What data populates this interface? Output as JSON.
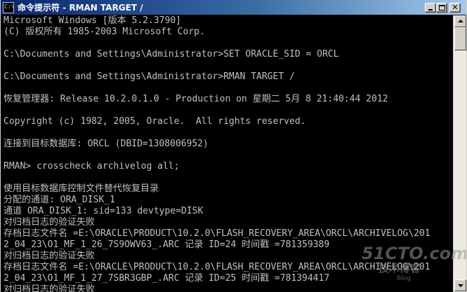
{
  "window": {
    "title": "命令提示符 - RMAN TARGET /",
    "icon": "cmd-icon",
    "icon_text": "C:\\",
    "controls": {
      "minimize": "minimize-icon",
      "maximize": "maximize-icon",
      "close": "close-icon",
      "close_glyph": "✕"
    }
  },
  "console": {
    "lines": [
      "Microsoft Windows [版本 5.2.3790]",
      "(C) 版权所有 1985-2003 Microsoft Corp.",
      "",
      "C:\\Documents and Settings\\Administrator>SET ORACLE_SID = ORCL",
      "",
      "C:\\Documents and Settings\\Administrator>RMAN TARGET /",
      "",
      "恢复管理器: Release 10.2.0.1.0 - Production on 星期二 5月 8 21:40:44 2012",
      "",
      "Copyright (c) 1982, 2005, Oracle.  All rights reserved.",
      "",
      "连接到目标数据库: ORCL (DBID=1308006952)",
      "",
      "RMAN> crosscheck archivelog all;",
      "",
      "使用目标数据库控制文件替代恢复目录",
      "分配的通道: ORA_DISK_1",
      "通道 ORA_DISK_1: sid=133 devtype=DISK",
      "对归档日志的验证失败",
      "存档日志文件名 =E:\\ORACLE\\PRODUCT\\10.2.0\\FLASH_RECOVERY_AREA\\ORCL\\ARCHIVELOG\\201",
      "2_04_23\\O1_MF_1_26_7S9OWV63_.ARC 记录 ID=24 时间戳 =781359389",
      "对归档日志的验证失败",
      "存档日志文件名 =E:\\ORACLE\\PRODUCT\\10.2.0\\FLASH_RECOVERY_AREA\\ORCL\\ARCHIVELOG\\201",
      "2_04_23\\O1_MF_1_27_7SBR3GBP_.ARC 记录 ID=25 时间戳 =781394417",
      "对归档日志的验证失败"
    ]
  },
  "scrollbar": {
    "up_icon": "arrow-up-icon",
    "down_icon": "arrow-down-icon"
  },
  "watermark": {
    "main": "51CTO.com",
    "sub": "技术博客",
    "site": "Blog"
  }
}
